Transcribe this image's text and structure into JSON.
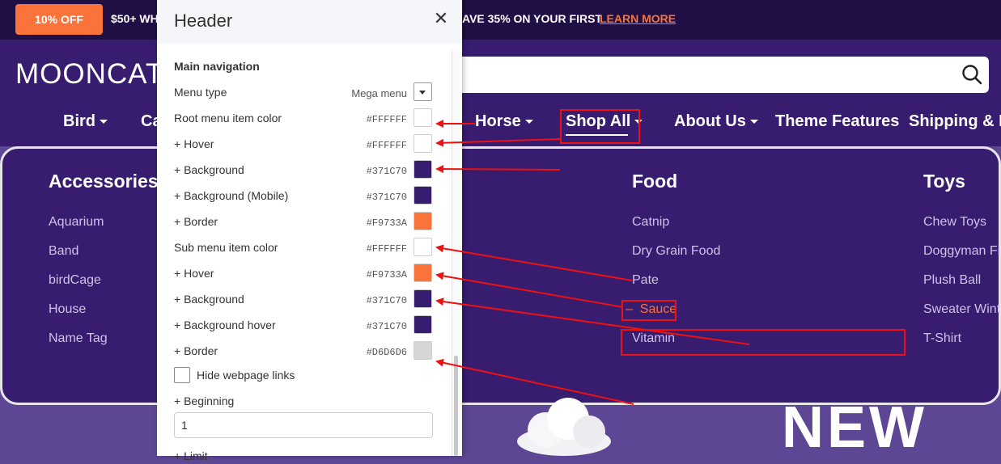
{
  "topbar": {
    "promo_badge": "10% OFF",
    "announcement_left": "$50+ WH",
    "announcement_right": "AVE 35% ON YOUR FIRST",
    "announcement_link": "LEARN MORE"
  },
  "header": {
    "logo": "MOONCAT",
    "search_icon": "search-icon",
    "nav": [
      {
        "label": "Bird"
      },
      {
        "label": "Ca"
      },
      {
        "label": "Horse"
      },
      {
        "label": "Shop All"
      },
      {
        "label": "About Us"
      },
      {
        "label": "Theme Features"
      },
      {
        "label": "Shipping & Re"
      }
    ]
  },
  "mega_menu": {
    "columns": [
      {
        "title": "Accessories",
        "items": [
          "Aquarium",
          "Band",
          "birdCage",
          "House",
          "Name Tag"
        ]
      },
      {
        "title": "Food",
        "items": [
          "Catnip",
          "Dry Grain Food",
          "Pate",
          "Sauce",
          "Vitamin"
        ]
      },
      {
        "title": "Toys",
        "items": [
          "Chew Toys",
          "Doggyman Fis",
          "Plush Ball",
          "Sweater Winte",
          "T-Shirt"
        ]
      }
    ],
    "hover_prefix": "–"
  },
  "hero": {
    "word": "NEW"
  },
  "panel": {
    "title": "Header",
    "close_icon": "close-icon",
    "section": "Main navigation",
    "menu_type_label": "Menu type",
    "menu_type_value": "Mega menu",
    "rows": [
      {
        "label": "Root menu item color",
        "value": "#FFFFFF",
        "color": "#FFFFFF"
      },
      {
        "label": "+ Hover",
        "value": "#FFFFFF",
        "color": "#FFFFFF"
      },
      {
        "label": "+ Background",
        "value": "#371C70",
        "color": "#371C70"
      },
      {
        "label": "+ Background (Mobile)",
        "value": "#371C70",
        "color": "#371C70"
      },
      {
        "label": "+ Border",
        "value": "#F9733A",
        "color": "#F9733A"
      },
      {
        "label": "Sub menu item color",
        "value": "#FFFFFF",
        "color": "#FFFFFF"
      },
      {
        "label": "+ Hover",
        "value": "#F9733A",
        "color": "#F9733A"
      },
      {
        "label": "+ Background",
        "value": "#371C70",
        "color": "#371C70"
      },
      {
        "label": "+ Background hover",
        "value": "#371C70",
        "color": "#371C70"
      },
      {
        "label": "+ Border",
        "value": "#D6D6D6",
        "color": "#D6D6D6"
      }
    ],
    "hide_links_label": "Hide webpage links",
    "beginning_label": "+ Beginning",
    "beginning_value": "1",
    "limit_label": "+ Limit"
  },
  "colors": {
    "brand_purple": "#371C70",
    "accent_orange": "#F9733A",
    "annotation_red": "#E11111"
  }
}
